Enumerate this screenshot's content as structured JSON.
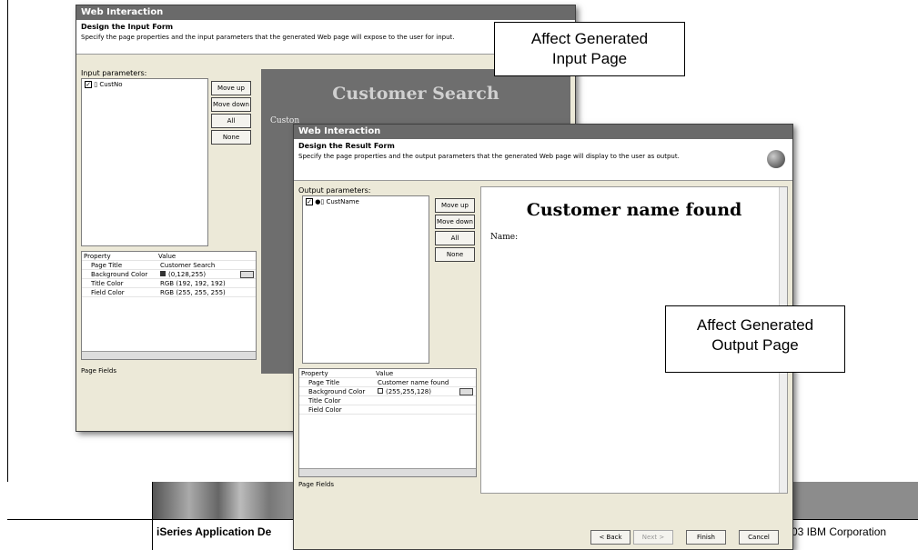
{
  "win1": {
    "title": "Web Interaction",
    "header_title": "Design the Input Form",
    "header_desc": "Specify the page properties and the input parameters that the generated Web page will expose to the user for input.",
    "params_label": "Input parameters:",
    "param_item": "CustNo",
    "buttons": {
      "move_up": "Move up",
      "move_down": "Move down",
      "all": "All",
      "none": "None"
    },
    "property_header": "Property",
    "value_header": "Value",
    "properties": [
      {
        "name": "Page Title",
        "value": "Customer Search"
      },
      {
        "name": "Background Color",
        "value": "(0,128,255)"
      },
      {
        "name": "Title Color",
        "value": "RGB (192, 192, 192)"
      },
      {
        "name": "Field Color",
        "value": "RGB (255, 255, 255)"
      }
    ],
    "tabs": "Page  Fields",
    "preview_title": "Customer Search",
    "preview_field_label": "Custon"
  },
  "win2": {
    "title": "Web Interaction",
    "header_title": "Design the Result Form",
    "header_desc": "Specify the page properties and the output parameters that the generated Web page will display to the user as output.",
    "params_label": "Output parameters:",
    "param_item": "CustName",
    "buttons": {
      "move_up": "Move up",
      "move_down": "Move down",
      "all": "All",
      "none": "None"
    },
    "property_header": "Property",
    "value_header": "Value",
    "properties": [
      {
        "name": "Page Title",
        "value": "Customer name found"
      },
      {
        "name": "Background Color",
        "value": "(255,255,128)"
      },
      {
        "name": "Title Color",
        "value": ""
      },
      {
        "name": "Field Color",
        "value": ""
      }
    ],
    "tabs": "Page  Fields",
    "preview_title": "Customer name found",
    "preview_field_label": "Name:",
    "nav": {
      "back": "< Back",
      "next": "Next >",
      "finish": "Finish",
      "cancel": "Cancel"
    }
  },
  "callouts": {
    "input": [
      "Affect Generated",
      "Input Page"
    ],
    "output": [
      "Affect Generated",
      "Output Page"
    ]
  },
  "footer": {
    "left": "iSeries Application De",
    "right": "03 IBM Corporation"
  },
  "colors": {
    "input_bg": "#6e6e6e",
    "output_bg": "#ffffff",
    "titlebar": "#6a6a6a"
  }
}
